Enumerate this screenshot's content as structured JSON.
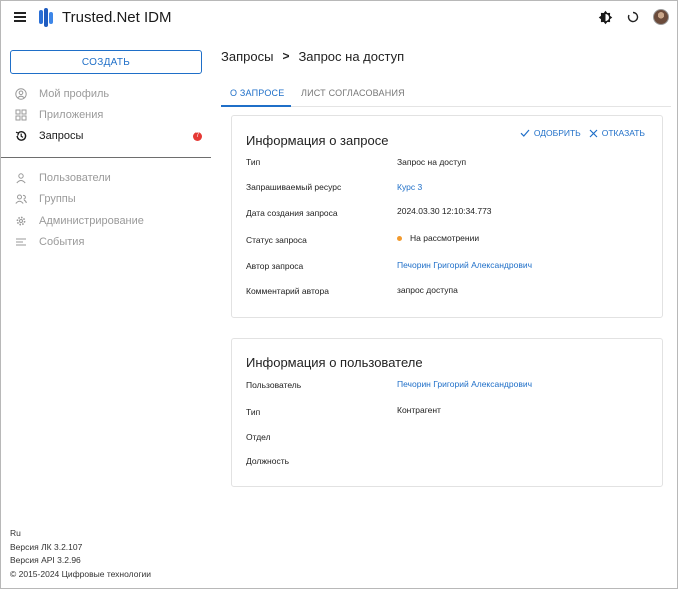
{
  "app": {
    "title": "Trusted.Net IDM"
  },
  "colors": {
    "accent": "#1f6fc8",
    "badge": "#e53935",
    "status_pending": "#f29a2e"
  },
  "sidebar": {
    "create_label": "СОЗДАТЬ",
    "items": [
      {
        "label": "Мой профиль",
        "icon": "profile-icon"
      },
      {
        "label": "Приложения",
        "icon": "apps-icon"
      },
      {
        "label": "Запросы",
        "icon": "history-icon",
        "badge": "7"
      },
      {
        "label": "Пользователи",
        "icon": "users-icon"
      },
      {
        "label": "Группы",
        "icon": "groups-icon"
      },
      {
        "label": "Администрирование",
        "icon": "gear-icon"
      },
      {
        "label": "События",
        "icon": "events-icon"
      }
    ],
    "footer": {
      "lang": "Ru",
      "version_lk": "Версия ЛК 3.2.107",
      "version_api": "Версия API 3.2.96",
      "copyright": "© 2015-2024 Цифровые технологии"
    }
  },
  "breadcrumb": {
    "parent": "Запросы",
    "sep": ">",
    "current": "Запрос на доступ"
  },
  "tabs": [
    "О ЗАПРОСЕ",
    "ЛИСТ СОГЛАСОВАНИЯ"
  ],
  "request_card": {
    "title": "Информация о запросе",
    "approve": "ОДОБРИТЬ",
    "reject": "ОТКАЗАТЬ",
    "rows": [
      {
        "label": "Тип",
        "value": "Запрос на доступ"
      },
      {
        "label": "Запрашиваемый ресурс",
        "value": "Курс 3"
      },
      {
        "label": "Дата создания запроса",
        "value": "2024.03.30 12:10:34.773"
      },
      {
        "label": "Статус запроса",
        "value": "На рассмотрении"
      },
      {
        "label": "Автор запроса",
        "value": "Печорин Григорий Александрович"
      },
      {
        "label": "Комментарий автора",
        "value": "запрос доступа"
      }
    ]
  },
  "user_card": {
    "title": "Информация о пользователе",
    "rows": [
      {
        "label": "Пользователь",
        "value": "Печорин Григорий Александрович"
      },
      {
        "label": "Тип",
        "value": "Контрагент"
      },
      {
        "label": "Отдел",
        "value": ""
      },
      {
        "label": "Должность",
        "value": ""
      }
    ]
  }
}
